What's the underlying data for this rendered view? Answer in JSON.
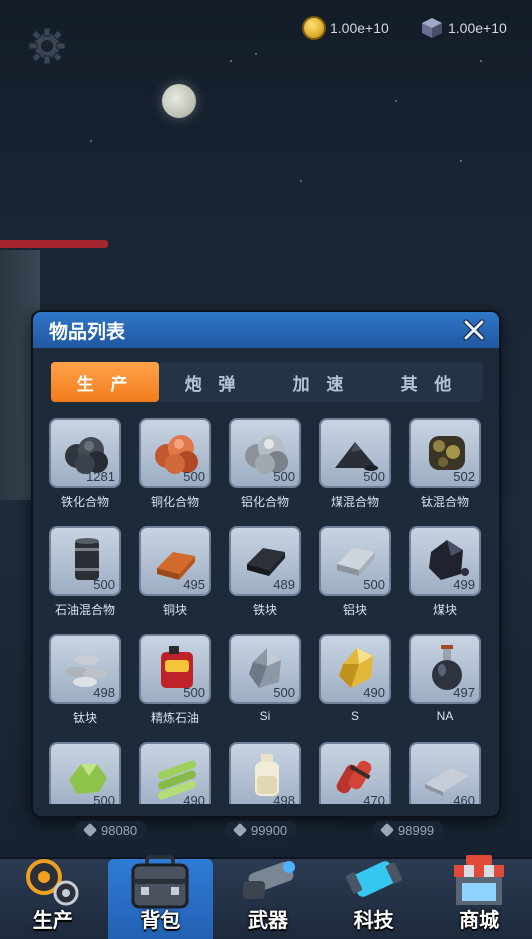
{
  "resources": {
    "coin": "1.00e+10",
    "gem": "1.00e+10"
  },
  "panel": {
    "title": "物品列表",
    "tabs": [
      "生 产",
      "炮 弹",
      "加 速",
      "其 他"
    ],
    "active_tab": 0
  },
  "items": [
    {
      "name": "铁化合物",
      "count": "1281",
      "icon": "iron-ore-icon"
    },
    {
      "name": "铜化合物",
      "count": "500",
      "icon": "copper-ore-icon"
    },
    {
      "name": "铝化合物",
      "count": "500",
      "icon": "aluminum-ore-icon"
    },
    {
      "name": "煤混合物",
      "count": "500",
      "icon": "coal-pile-icon"
    },
    {
      "name": "钛混合物",
      "count": "502",
      "icon": "titanium-ore-icon"
    },
    {
      "name": "石油混合物",
      "count": "500",
      "icon": "oil-barrel-icon"
    },
    {
      "name": "铜块",
      "count": "495",
      "icon": "copper-ingot-icon"
    },
    {
      "name": "铁块",
      "count": "489",
      "icon": "iron-ingot-icon"
    },
    {
      "name": "铝块",
      "count": "500",
      "icon": "aluminum-ingot-icon"
    },
    {
      "name": "煤块",
      "count": "499",
      "icon": "coal-block-icon"
    },
    {
      "name": "钛块",
      "count": "498",
      "icon": "titanium-coins-icon"
    },
    {
      "name": "精炼石油",
      "count": "500",
      "icon": "oil-can-icon"
    },
    {
      "name": "Si",
      "count": "500",
      "icon": "silicon-crystal-icon"
    },
    {
      "name": "S",
      "count": "490",
      "icon": "sulfur-crystal-icon"
    },
    {
      "name": "NA",
      "count": "497",
      "icon": "sodium-flask-icon"
    },
    {
      "name": "",
      "count": "500",
      "icon": "green-crystal-icon"
    },
    {
      "name": "",
      "count": "490",
      "icon": "green-bars-icon"
    },
    {
      "name": "",
      "count": "498",
      "icon": "bottle-icon"
    },
    {
      "name": "",
      "count": "470",
      "icon": "dynamite-icon"
    },
    {
      "name": "",
      "count": "460",
      "icon": "metal-plate-icon"
    }
  ],
  "scores": [
    "98080",
    "99900",
    "98999"
  ],
  "nav": [
    {
      "label": "生产",
      "icon": "gears-icon"
    },
    {
      "label": "背包",
      "icon": "toolbox-icon"
    },
    {
      "label": "武器",
      "icon": "cannon-icon"
    },
    {
      "label": "科技",
      "icon": "energy-cell-icon"
    },
    {
      "label": "商城",
      "icon": "shop-icon"
    }
  ],
  "colors": {
    "tab_active": "#f27c1c",
    "header": "#2f77c9",
    "nav_active": "#2f7bd6"
  }
}
